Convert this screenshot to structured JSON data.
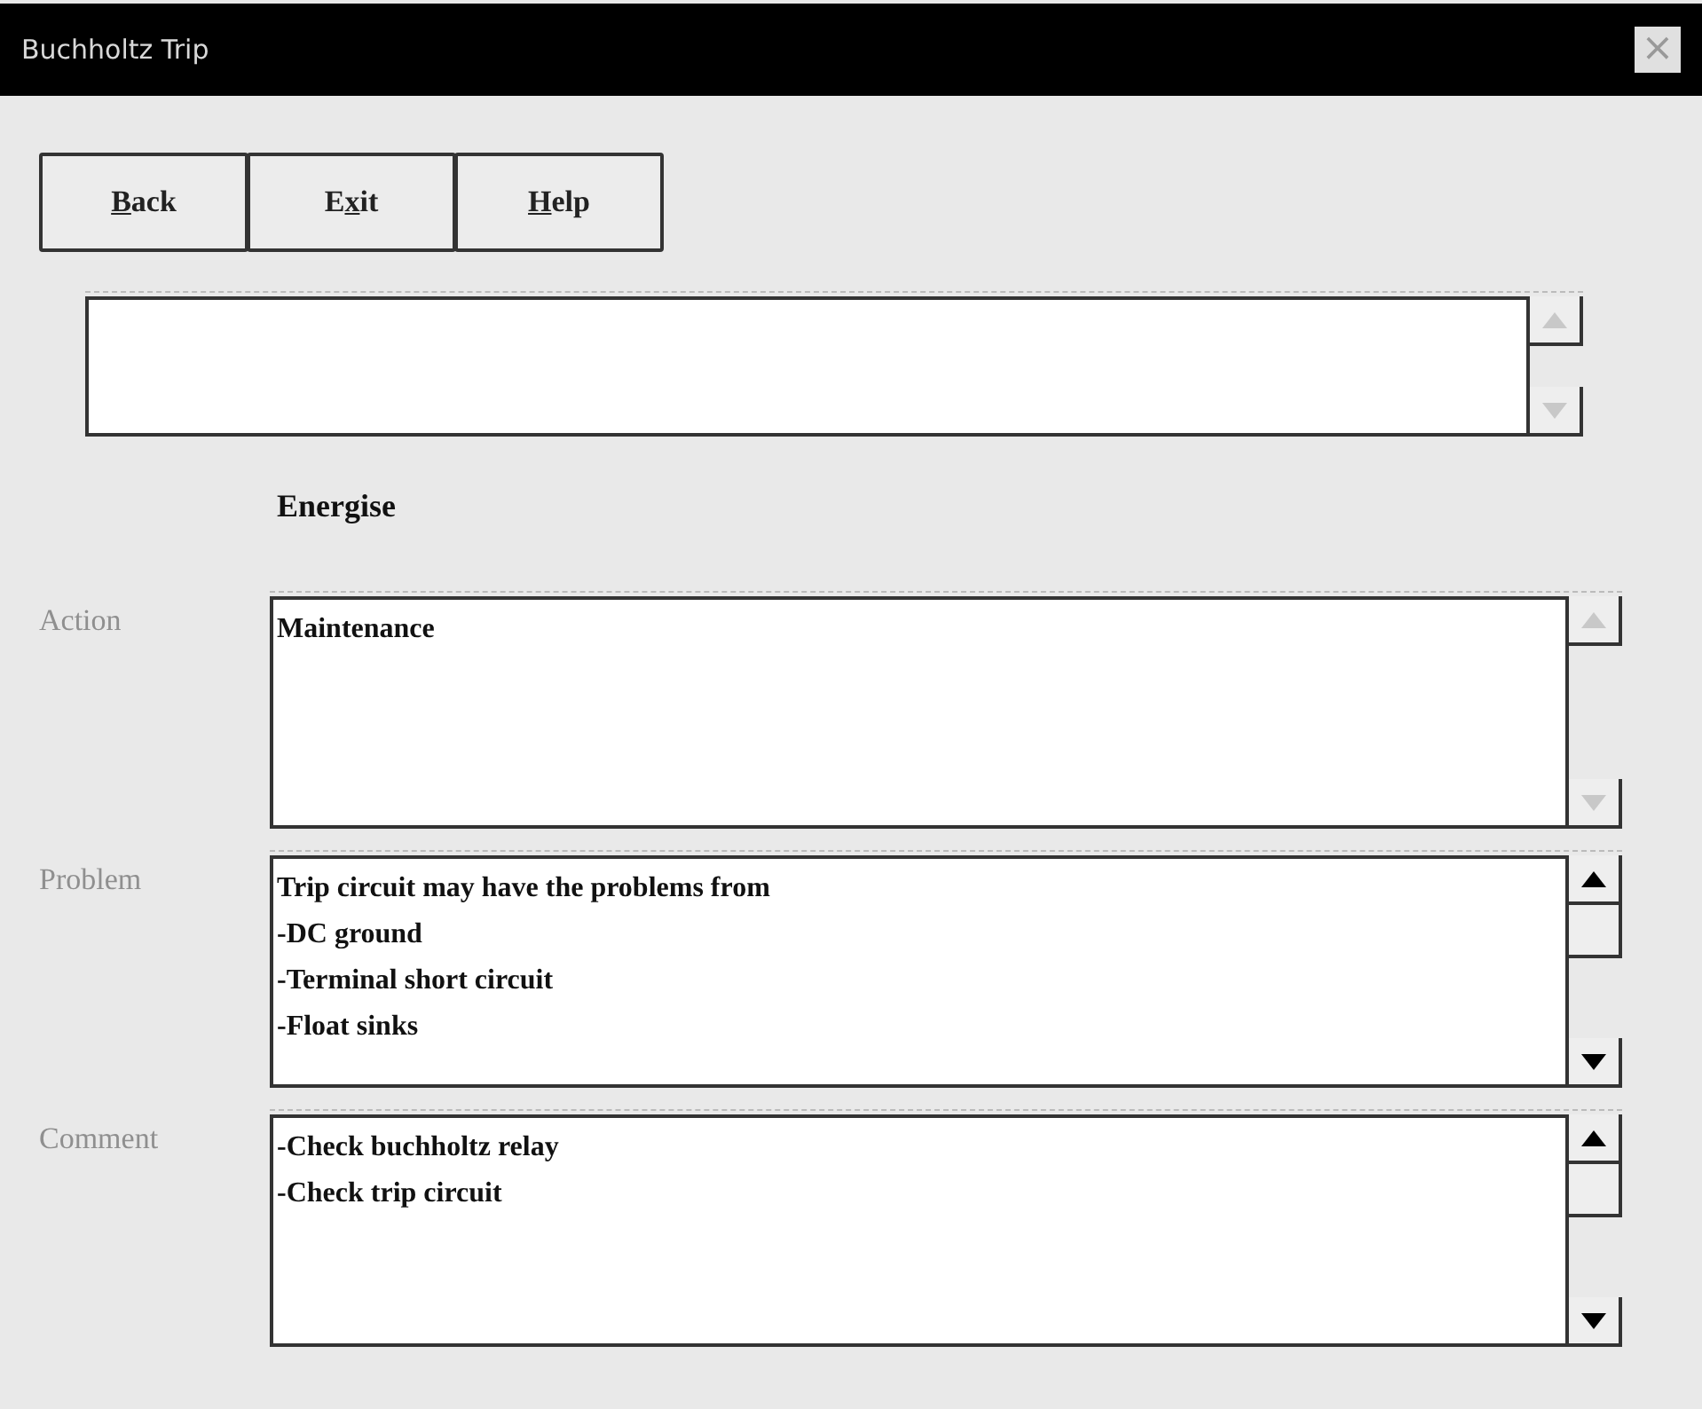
{
  "window": {
    "title": "Buchholtz Trip",
    "close": "×"
  },
  "buttons": [
    {
      "parts": [
        {
          "text": "B",
          "underlined": true
        },
        {
          "text": "ack",
          "underlined": false
        }
      ]
    },
    {
      "parts": [
        {
          "text": "E",
          "underlined": false
        },
        {
          "text": "x",
          "underlined": true
        },
        {
          "text": "it",
          "underlined": false
        }
      ]
    },
    {
      "parts": [
        {
          "text": "H",
          "underlined": true
        },
        {
          "text": "elp",
          "underlined": false
        }
      ]
    }
  ],
  "message_box": {
    "scrollable": false
  },
  "heading": "Energise",
  "fields": [
    {
      "label": "Action",
      "value": "Maintenance",
      "scrollable": false
    },
    {
      "label": "Problem",
      "value": "Trip circuit may have the problems from\n-DC ground\n-Terminal short circuit\n-Float sinks",
      "scrollable": true
    },
    {
      "label": "Comment",
      "value": "-Check buchholtz relay\n-Check trip circuit",
      "scrollable": true
    }
  ]
}
